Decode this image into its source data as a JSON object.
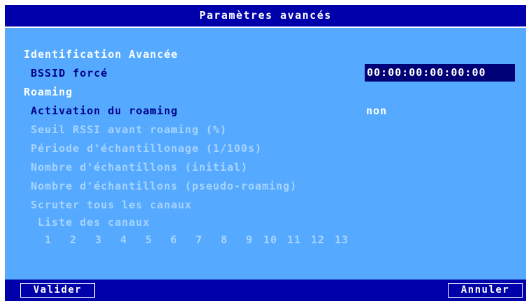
{
  "dialog": {
    "title": "Paramètres avancés"
  },
  "sections": {
    "identification": "Identification Avancée",
    "roaming": "Roaming"
  },
  "fields": {
    "bssid_label": "BSSID forcé",
    "bssid_value": "00:00:00:00:00:00",
    "roaming_activation_label": "Activation du roaming",
    "roaming_activation_value": "non",
    "rssi_threshold_label": "Seuil RSSI avant roaming (%)",
    "sampling_period_label": "Période d'échantillonage (1/100s)",
    "samples_initial_label": "Nombre d'échantillons (initial)",
    "samples_pseudo_label": "Nombre d'échantillons (pseudo-roaming)",
    "scan_all_label": "Scruter tous les canaux",
    "channel_list_label": "Liste des canaux"
  },
  "channels": [
    "1",
    "2",
    "3",
    "4",
    "5",
    "6",
    "7",
    "8",
    "9",
    "10",
    "11",
    "12",
    "13"
  ],
  "buttons": {
    "validate": "Valider",
    "cancel": "Annuler"
  },
  "colors": {
    "background": "#55aaff",
    "titlebar": "#0000aa",
    "selected_field": "#000077",
    "active_text": "#000088",
    "disabled_text": "#a8d4ff",
    "section_text": "#ffffff"
  }
}
